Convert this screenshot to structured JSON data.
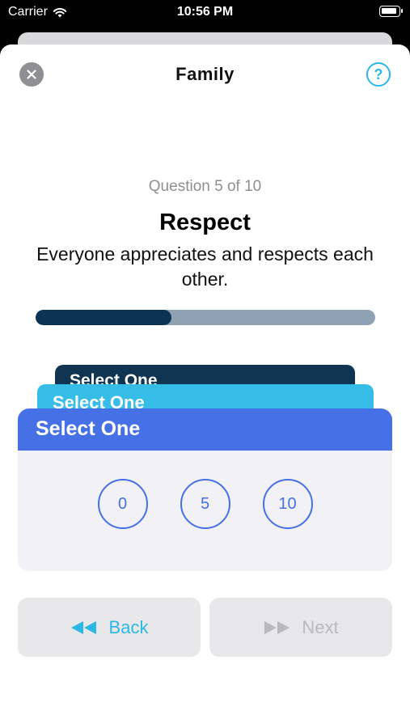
{
  "status_bar": {
    "carrier": "Carrier",
    "time": "10:56 PM"
  },
  "nav": {
    "title": "Family",
    "help_label": "?"
  },
  "question": {
    "counter": "Question 5 of 10",
    "title": "Respect",
    "description": "Everyone appreciates and respects each other.",
    "progress_fraction": 0.4
  },
  "cards": {
    "back_2_label": "Select One",
    "back_1_label": "Select One",
    "front_label": "Select One",
    "options": [
      "0",
      "5",
      "10"
    ]
  },
  "buttons": {
    "back_label": "Back",
    "next_label": "Next"
  },
  "colors": {
    "accent": "#2bb8e6",
    "card_blue": "#4670e6",
    "card_cyan": "#35bde8",
    "card_navy": "#0f3553",
    "progress_fill": "#0d3352",
    "progress_track": "#8ea2b3",
    "disabled": "#b9b9bd"
  }
}
